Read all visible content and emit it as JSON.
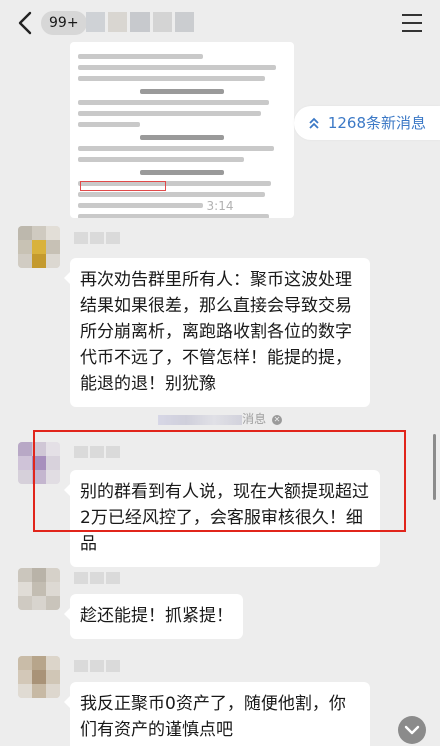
{
  "header": {
    "unread_badge": "99+"
  },
  "new_messages_pill": {
    "label": "1268条新消息"
  },
  "time_divider": "3:14",
  "system_notice": {
    "suffix": "消息"
  },
  "messages": [
    {
      "text": "再次劝告群里所有人：聚币这波处理结果如果很差，那么直接会导致交易所分崩离析，离跑路收割各位的数字代币不远了，不管怎样！能提的提，能退的退！别犹豫"
    },
    {
      "text": "别的群看到有人说，现在大额提现超过2万已经风控了，会客服审核很久！细品"
    },
    {
      "text": "趁还能提！抓紧提！"
    },
    {
      "text": "我反正聚币0资产了，随便他割，你们有资产的谨慎点吧"
    }
  ],
  "icons": {
    "back": "chevron-left-icon",
    "menu": "hamburger-menu-icon",
    "new_messages": "double-chevron-up-icon",
    "scroll_down": "chevron-down-icon"
  },
  "colors": {
    "background": "#ededed",
    "bubble": "#ffffff",
    "link_blue": "#3c79c6",
    "highlight_red": "#e1251b"
  }
}
